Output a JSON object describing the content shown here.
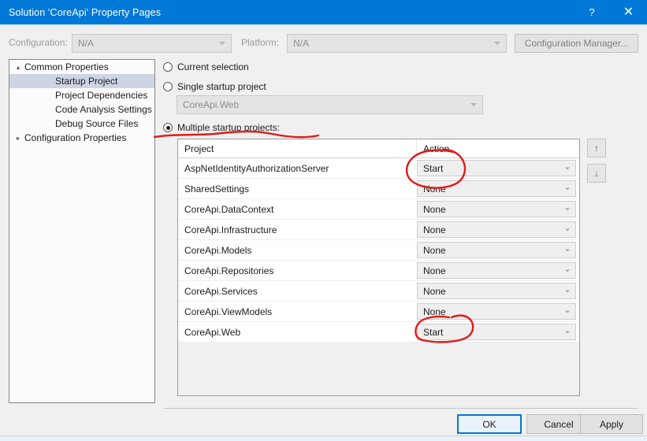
{
  "window": {
    "title": "Solution 'CoreApi' Property Pages",
    "help_icon": "?",
    "close_icon": "✕",
    "titlebar_color": "#0078d7"
  },
  "config_bar": {
    "configuration_label": "Configuration:",
    "configuration_value": "N/A",
    "platform_label": "Platform:",
    "platform_value": "N/A",
    "configuration_manager_label": "Configuration Manager..."
  },
  "tree": {
    "items": [
      {
        "label": "Common Properties",
        "level": 1,
        "glyph": "▴",
        "selected": false
      },
      {
        "label": "Startup Project",
        "level": 2,
        "glyph": "",
        "selected": true
      },
      {
        "label": "Project Dependencies",
        "level": 2,
        "glyph": "",
        "selected": false
      },
      {
        "label": "Code Analysis Settings",
        "level": 2,
        "glyph": "",
        "selected": false
      },
      {
        "label": "Debug Source Files",
        "level": 2,
        "glyph": "",
        "selected": false
      },
      {
        "label": "Configuration Properties",
        "level": 1,
        "glyph": "▸",
        "selected": false
      }
    ]
  },
  "startup": {
    "current_selection_label": "Current selection",
    "single_startup_label": "Single startup project",
    "single_startup_value": "CoreApi.Web",
    "multiple_startup_label": "Multiple startup projects:",
    "selected_option": "multiple"
  },
  "grid": {
    "columns": [
      "Project",
      "Action"
    ],
    "rows": [
      {
        "project": "AspNetIdentityAuthorizationServer",
        "action": "Start"
      },
      {
        "project": "SharedSettings",
        "action": "None"
      },
      {
        "project": "CoreApi.DataContext",
        "action": "None"
      },
      {
        "project": "CoreApi.Infrastructure",
        "action": "None"
      },
      {
        "project": "CoreApi.Models",
        "action": "None"
      },
      {
        "project": "CoreApi.Repositories",
        "action": "None"
      },
      {
        "project": "CoreApi.Services",
        "action": "None"
      },
      {
        "project": "CoreApi.ViewModels",
        "action": "None"
      },
      {
        "project": "CoreApi.Web",
        "action": "Start"
      }
    ]
  },
  "order_buttons": {
    "move_up_glyph": "↑",
    "move_down_glyph": "↓"
  },
  "footer": {
    "ok_label": "OK",
    "cancel_label": "Cancel",
    "apply_label": "Apply"
  },
  "annotations": {
    "color": "#e01b1b",
    "marks": [
      {
        "name": "underline-multiple-startup",
        "shape": "squiggle"
      },
      {
        "name": "circle-start-first-row",
        "shape": "ellipse"
      },
      {
        "name": "circle-start-web-row",
        "shape": "rounded-box"
      }
    ]
  }
}
